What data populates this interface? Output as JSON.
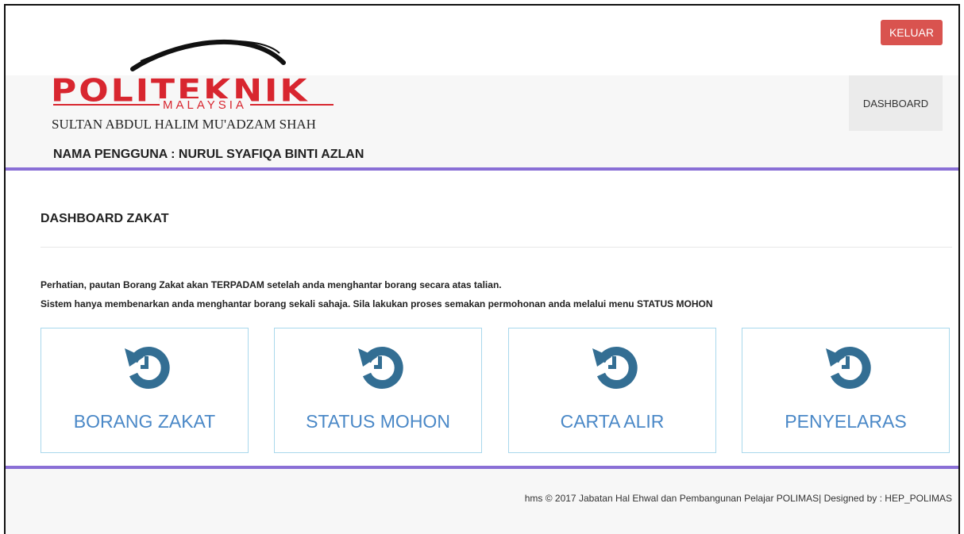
{
  "header": {
    "logout_label": "KELUAR",
    "logo": {
      "brand": "POLITEKNIK",
      "country": "MALAYSIA",
      "campus": "SULTAN ABDUL HALIM MU'ADZAM SHAH"
    },
    "username_line": "NAMA PENGGUNA : NURUL SYAFIQA BINTI AZLAN",
    "nav": {
      "dashboard_label": "DASHBOARD"
    }
  },
  "main": {
    "title": "DASHBOARD ZAKAT",
    "notice1": "Perhatian, pautan Borang Zakat akan TERPADAM setelah anda menghantar borang secara atas talian.",
    "notice2": "Sistem hanya membenarkan anda menghantar borang sekali sahaja. Sila lakukan proses semakan permohonan anda melalui menu STATUS MOHON",
    "tiles": [
      {
        "label": "BORANG ZAKAT",
        "icon": "history-icon"
      },
      {
        "label": "STATUS MOHON",
        "icon": "history-icon"
      },
      {
        "label": "CARTA ALIR",
        "icon": "history-icon"
      },
      {
        "label": "PENYELARAS",
        "icon": "history-icon"
      }
    ]
  },
  "footer": {
    "text": "hms © 2017 Jabatan Hal Ehwal dan Pembangunan Pelajar POLIMAS| Designed by : HEP_POLIMAS"
  },
  "colors": {
    "accent_purple": "#8a6fd6",
    "logout_red": "#d9534f",
    "logo_red": "#d8262f",
    "icon_blue": "#336e93",
    "tile_label_blue": "#4a88c7",
    "tile_border": "#a9d8ec"
  }
}
